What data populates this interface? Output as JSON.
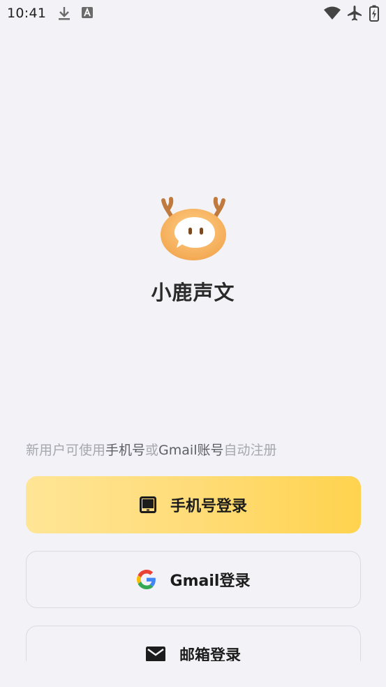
{
  "status_bar": {
    "time": "10:41",
    "icons": [
      "download-icon",
      "a-badge-icon",
      "wifi-icon",
      "airplane-icon",
      "battery-charging-icon"
    ]
  },
  "app": {
    "name": "小鹿声文",
    "logo": "deer-chat-logo"
  },
  "hint": {
    "part1": "新用户可使用",
    "part2": "手机号",
    "part3": "或",
    "part4": "Gmail账号",
    "part5": "自动注册"
  },
  "buttons": {
    "phone_label": "手机号登录",
    "gmail_label": "Gmail登录",
    "email_label": "邮箱登录"
  },
  "colors": {
    "background": "#f3f2f7",
    "primary_gradient_start": "#ffe596",
    "primary_gradient_end": "#ffd34e",
    "hint_text": "#a6a8ae",
    "hint_emphasis": "#5d5f65"
  }
}
